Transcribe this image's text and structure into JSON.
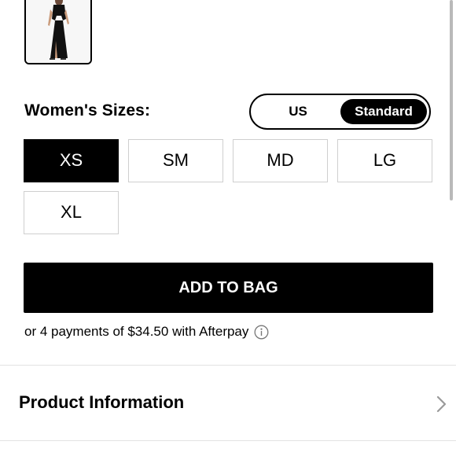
{
  "product": {
    "thumbnail_alt": "black cutout maxi dress thumbnail"
  },
  "sizes": {
    "label": "Women's Sizes:",
    "toggle": [
      {
        "label": "US",
        "selected": false
      },
      {
        "label": "Standard",
        "selected": true
      }
    ],
    "options": [
      {
        "label": "XS",
        "selected": true
      },
      {
        "label": "SM",
        "selected": false
      },
      {
        "label": "MD",
        "selected": false
      },
      {
        "label": "LG",
        "selected": false
      },
      {
        "label": "XL",
        "selected": false
      }
    ]
  },
  "cart": {
    "add_label": "ADD TO BAG",
    "afterpay_text": "or 4 payments of $34.50 with Afterpay"
  },
  "sections": [
    {
      "title": "Product Information"
    }
  ],
  "icons": {
    "info": "info-circle-icon",
    "chevron": "chevron-right-icon"
  },
  "colors": {
    "primary": "#000000",
    "border": "#cfcfcf",
    "divider": "#e3e3e3"
  }
}
